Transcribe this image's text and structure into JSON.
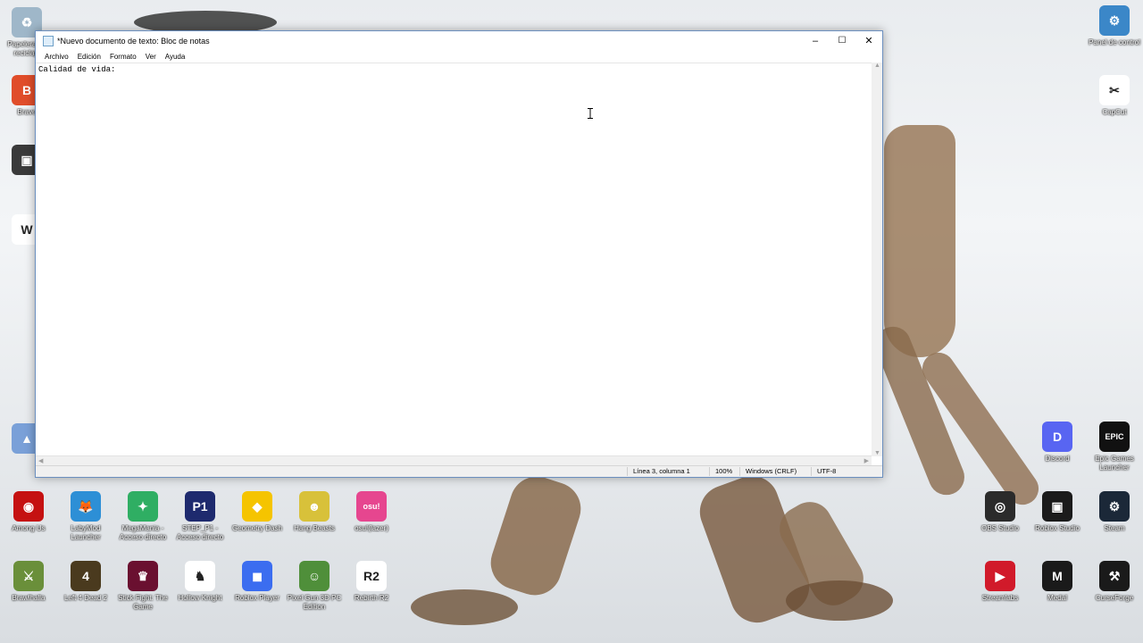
{
  "window": {
    "title": "*Nuevo documento de texto: Bloc de notas",
    "buttons": {
      "minimize": "–",
      "maximize": "☐",
      "close": "✕"
    },
    "menu": [
      "Archivo",
      "Edición",
      "Formato",
      "Ver",
      "Ayuda"
    ],
    "content": "Calidad de vida:",
    "status": {
      "position": "Línea 3, columna 1",
      "zoom": "100%",
      "line_endings": "Windows (CRLF)",
      "encoding": "UTF-8"
    }
  },
  "desktop": {
    "left_icons": [
      {
        "label": "Papelera de reciclaje",
        "icon": "recycle-bin-icon",
        "color": "#9fb7c9",
        "glyph": "♻"
      },
      {
        "label": "Brave",
        "icon": "brave-icon",
        "color": "#e04d2a",
        "glyph": "B"
      },
      {
        "label": "",
        "icon": "shortcut-icon",
        "color": "#3a3a3a",
        "glyph": "▣"
      },
      {
        "label": "",
        "icon": "document-icon",
        "color": "#ffffff",
        "glyph": "W"
      },
      {
        "label": "",
        "icon": "app-icon",
        "color": "#7aa0d8",
        "glyph": "▲"
      }
    ],
    "right_icons": [
      {
        "label": "Panel de control",
        "icon": "control-panel-icon",
        "color": "#3b87c8",
        "glyph": "⚙"
      },
      {
        "label": "CapCut",
        "icon": "capcut-icon",
        "color": "#ffffff",
        "glyph": "✂"
      },
      {
        "label": "Discord",
        "icon": "discord-icon",
        "color": "#5865f2",
        "glyph": "D"
      },
      {
        "label": "Epic Games Launcher",
        "icon": "epic-games-icon",
        "color": "#111111",
        "glyph": "EPIC"
      }
    ],
    "bottom_row1": [
      {
        "label": "Among Us",
        "icon": "among-us-icon",
        "color": "#c51111",
        "glyph": "◉"
      },
      {
        "label": "LabyMod Launcher",
        "icon": "labymod-icon",
        "color": "#2d8fd6",
        "glyph": "🦊"
      },
      {
        "label": "MegaMania - Acceso directo",
        "icon": "megamania-icon",
        "color": "#2fae63",
        "glyph": "✦"
      },
      {
        "label": "STEP_P1 - Acceso directo",
        "icon": "step-p1-icon",
        "color": "#1e2a6e",
        "glyph": "P1"
      },
      {
        "label": "Geometry Dash",
        "icon": "geometry-dash-icon",
        "color": "#f5c400",
        "glyph": "◆"
      },
      {
        "label": "Hang Beasts",
        "icon": "hang-beasts-icon",
        "color": "#d8c13a",
        "glyph": "☻"
      },
      {
        "label": "osu!(lazer)",
        "icon": "osu-icon",
        "color": "#e6468f",
        "glyph": "osu!"
      }
    ],
    "bottom_row1_right": [
      {
        "label": "OBS Studio",
        "icon": "obs-icon",
        "color": "#2b2b2b",
        "glyph": "◎"
      },
      {
        "label": "Roblox Studio",
        "icon": "roblox-studio-icon",
        "color": "#1b1b1b",
        "glyph": "▣"
      },
      {
        "label": "Steam",
        "icon": "steam-icon",
        "color": "#1b2838",
        "glyph": "⚙"
      }
    ],
    "bottom_row2": [
      {
        "label": "Brawlhalla",
        "icon": "brawlhalla-icon",
        "color": "#6a8f3a",
        "glyph": "⚔"
      },
      {
        "label": "Left 4 Dead 2",
        "icon": "left4dead-icon",
        "color": "#4a3a1e",
        "glyph": "4"
      },
      {
        "label": "Stick Fight: The Game",
        "icon": "stick-fight-icon",
        "color": "#6a1030",
        "glyph": "♛"
      },
      {
        "label": "Hollow Knight",
        "icon": "hollow-knight-icon",
        "color": "#ffffff",
        "glyph": "♞"
      },
      {
        "label": "Roblox Player",
        "icon": "roblox-icon",
        "color": "#3b6df0",
        "glyph": "◼"
      },
      {
        "label": "Pixel Gun 3D PC Edition",
        "icon": "pixel-gun-icon",
        "color": "#4f8f3a",
        "glyph": "☺"
      },
      {
        "label": "Rebirth R2",
        "icon": "r2-icon",
        "color": "#ffffff",
        "glyph": "R2"
      }
    ],
    "bottom_row2_right": [
      {
        "label": "Streamlabs",
        "icon": "streamlabs-icon",
        "color": "#d11a2a",
        "glyph": "▶"
      },
      {
        "label": "Medal",
        "icon": "medal-icon",
        "color": "#1a1a1a",
        "glyph": "M"
      },
      {
        "label": "CurseForge",
        "icon": "curseforge-icon",
        "color": "#1a1a1a",
        "glyph": "⚒"
      }
    ]
  }
}
